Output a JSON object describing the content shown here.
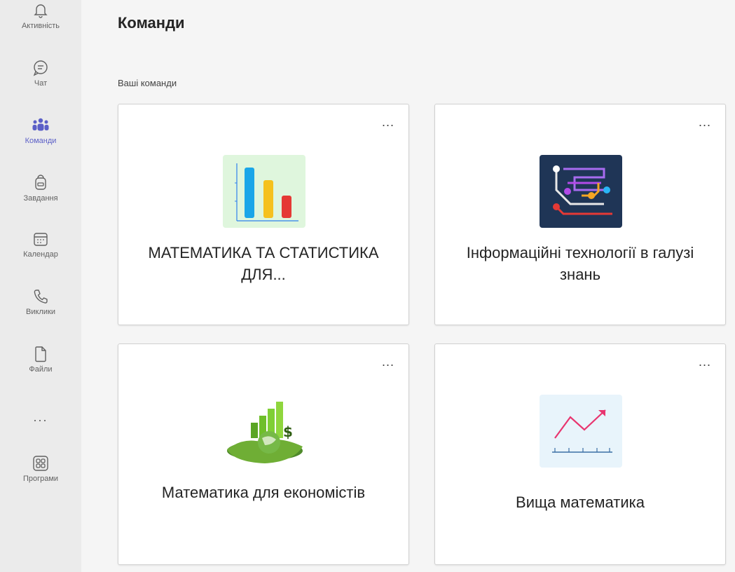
{
  "rail": {
    "items": [
      {
        "label": "Активність",
        "icon": "bell-icon"
      },
      {
        "label": "Чат",
        "icon": "chat-icon"
      },
      {
        "label": "Команди",
        "icon": "teams-icon",
        "active": true
      },
      {
        "label": "Завдання",
        "icon": "backpack-icon"
      },
      {
        "label": "Календар",
        "icon": "calendar-icon"
      },
      {
        "label": "Виклики",
        "icon": "phone-icon"
      },
      {
        "label": "Файли",
        "icon": "file-icon"
      },
      {
        "label": "...",
        "icon": "more-icon"
      },
      {
        "label": "Програми",
        "icon": "apps-icon"
      }
    ]
  },
  "page": {
    "title": "Команди",
    "section_label": "Ваші команди"
  },
  "teams": [
    {
      "name": "МАТЕМАТИКА ТА СТАТИСТИКА ДЛЯ...",
      "more": "...",
      "icon": "bar-chart-icon"
    },
    {
      "name": "Інформаційні технології в галузі знань",
      "more": "...",
      "icon": "circuit-icon"
    },
    {
      "name": "Математика для економістів",
      "more": "...",
      "icon": "globe-money-icon"
    },
    {
      "name": "Вища математика",
      "more": "...",
      "icon": "trend-line-icon"
    }
  ],
  "colors": {
    "accent": "#5b5fc7",
    "rail_bg": "#ebebeb",
    "page_bg": "#f5f5f5"
  }
}
